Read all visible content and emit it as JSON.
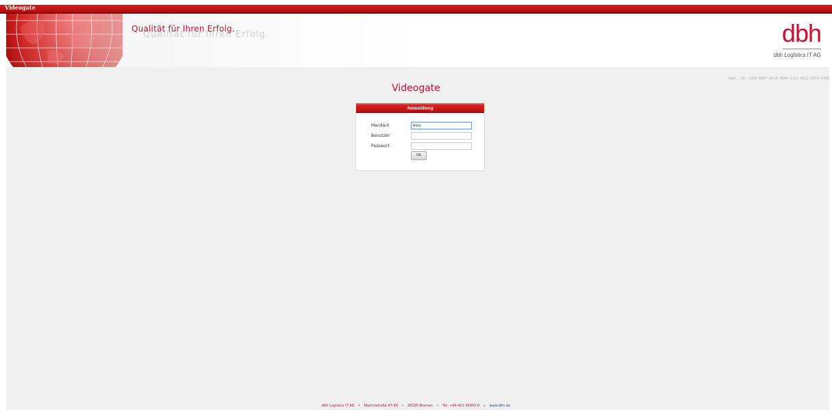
{
  "window": {
    "title": "Videogate"
  },
  "header": {
    "slogan": "Qualität für Ihren Erfolg.",
    "slogan_ghost": "Qualität für Ihren Erfolg.",
    "logo_text": "dbh",
    "logo_company": "dbh Logistics IT AG",
    "appl_id": "Appl.-ID: 12EA-EE97-AC1A-5BA6-11CC-0822-E1FA-839E"
  },
  "main": {
    "title": "Videogate"
  },
  "login": {
    "header": "Anmeldung",
    "mandant_label": "Mandant",
    "mandant_value": "evu",
    "benutzer_label": "Benutzer",
    "benutzer_value": "",
    "passwort_label": "Passwort",
    "passwort_value": "",
    "ok_label": "OK"
  },
  "footer": {
    "company": "dbh Logistics IT AG",
    "street": "Martinistraße 47-49",
    "city": "28195 Bremen",
    "phone": "Tel. +49 421 30902-0",
    "website": "www.dbh.de",
    "separator": "•"
  },
  "colors": {
    "brand_red": "#c8102e",
    "background": "#f0f0f0"
  }
}
